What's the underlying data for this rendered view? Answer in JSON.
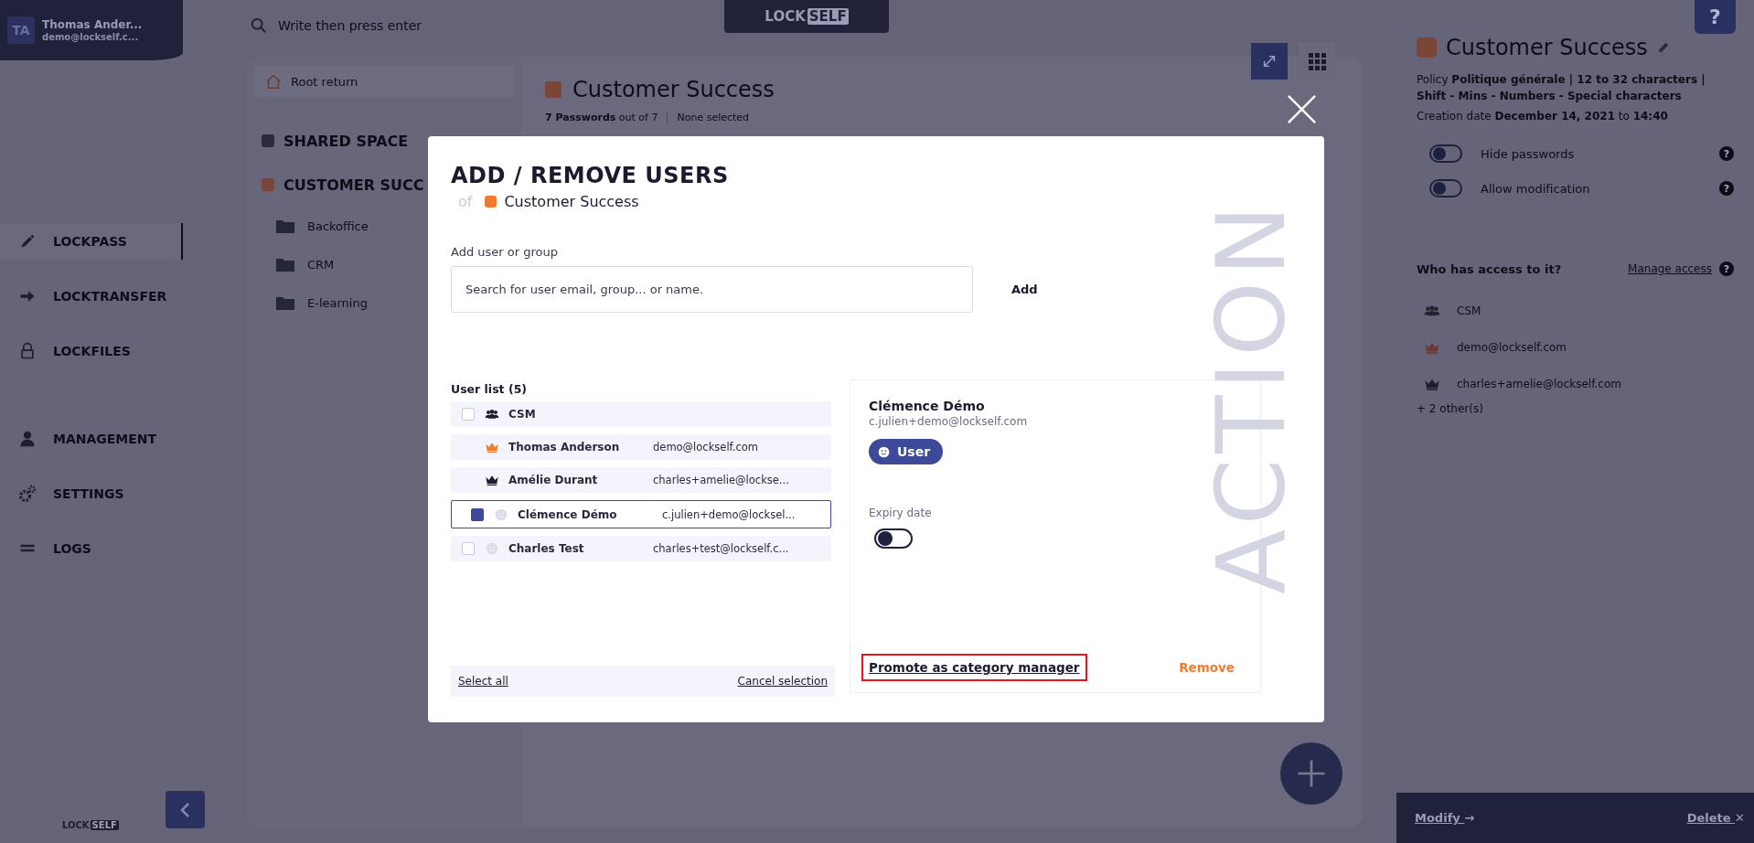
{
  "sidebar": {
    "profile": {
      "initials": "TA",
      "name": "Thomas Ander...",
      "email": "demo@lockself.c..."
    },
    "nav_groups": [
      [
        {
          "label": "LOCKPASS",
          "selected": true
        },
        {
          "label": "LOCKTRANSFER",
          "selected": false
        },
        {
          "label": "LOCKFILES",
          "selected": false
        }
      ],
      [
        {
          "label": "MANAGEMENT",
          "selected": false
        },
        {
          "label": "SETTINGS",
          "selected": false
        },
        {
          "label": "LOGS",
          "selected": false
        }
      ]
    ],
    "logo": {
      "part_1": "LOCK",
      "part_2": "SELF"
    }
  },
  "top_bar": {
    "search_placeholder": "Write then press enter",
    "logo": {
      "part_1": "LOCK",
      "part_2": "SELF"
    }
  },
  "tree": {
    "root_return": "Root return",
    "spaces": [
      {
        "label": "SHARED SPACE",
        "color": "#2c2b3b"
      },
      {
        "label": "CUSTOMER SUCC",
        "color": "#7b4538",
        "children": [
          {
            "label": "Backoffice"
          },
          {
            "label": "CRM"
          },
          {
            "label": "E-learning"
          }
        ]
      }
    ]
  },
  "content": {
    "title": "Customer Success",
    "count": "**7 Passwords** out of 7",
    "selection": "None selected"
  },
  "details": {
    "title": "Customer Success",
    "policy": "Policy  **Politique générale | 12 to 32 characters | Shift - Mins - Numbers - Special characters**",
    "creation": "Creation date  **December 14, 2021** to  **14:40**",
    "toggles": [
      {
        "label": "Hide passwords",
        "on": false,
        "help": "?"
      },
      {
        "label": "Allow modification",
        "on": false,
        "help": "?"
      }
    ],
    "access_title": "Who has access to it?",
    "manage_access": "Manage access",
    "access_help": "?",
    "access": [
      {
        "kind": "group",
        "label": "CSM"
      },
      {
        "kind": "owner",
        "label": "demo@lockself.com"
      },
      {
        "kind": "manager",
        "label": "charles+amelie@lockself.com"
      }
    ],
    "more": "+ 2 other(s)",
    "modify": "Modify",
    "modify_arrow": "→",
    "delete": "Delete",
    "delete_mark": "✕",
    "help_button": "?"
  },
  "modal": {
    "title": "ADD / REMOVE USERS",
    "of": "of",
    "category": "Customer Success",
    "add_label": "Add user or group",
    "search_placeholder": "Search for user email, group... or name.",
    "add_button": "Add",
    "list_title": "User list (5)",
    "users": [
      {
        "kind": "group",
        "name": "CSM",
        "checked": false,
        "selected": false
      },
      {
        "kind": "owner",
        "name": "Thomas Anderson",
        "email": "demo@lockself.com",
        "selected": false
      },
      {
        "kind": "manager",
        "name": "Amélie Durant",
        "email": "charles+amelie@lockse...",
        "selected": false
      },
      {
        "kind": "user",
        "name": "Clémence Démo",
        "email": "c.julien+demo@locksel...",
        "checked": true,
        "selected": true
      },
      {
        "kind": "user",
        "name": "Charles Test",
        "email": "charles+test@lockself.c...",
        "checked": false,
        "selected": false
      }
    ],
    "select_all": "Select all",
    "cancel_selection": "Cancel selection",
    "detail": {
      "name": "Clémence Démo",
      "email": "c.julien+demo@lockself.com",
      "role": "User",
      "expiry_label": "Expiry date",
      "expiry_on": false,
      "promote": "Promote as category manager",
      "promote_highlighted": true,
      "remove": "Remove"
    },
    "watermark": "ACTION"
  }
}
